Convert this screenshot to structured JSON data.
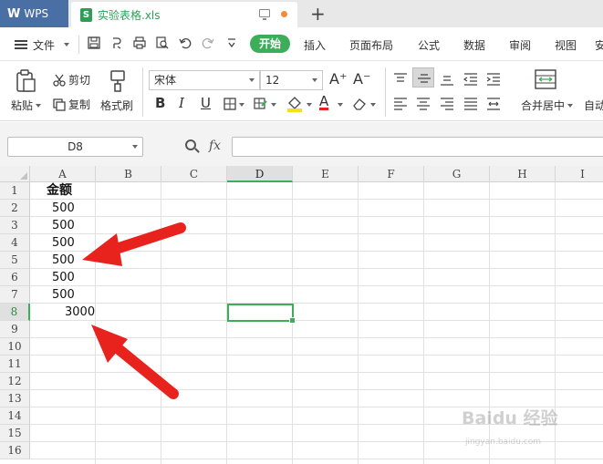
{
  "titlebar": {
    "app_name": "WPS",
    "document_name": "实验表格.xls",
    "sheet_icon_letter": "S",
    "new_tab_glyph": "+"
  },
  "menu": {
    "file_label": "文件",
    "tabs": [
      "开始",
      "插入",
      "页面布局",
      "公式",
      "数据",
      "审阅",
      "视图",
      "安"
    ]
  },
  "ribbon": {
    "paste": "粘贴",
    "cut": "剪切",
    "copy": "复制",
    "format_painter": "格式刷",
    "font_name": "宋体",
    "font_size": "12",
    "grow_font": "A⁺",
    "shrink_font": "A⁻",
    "bold": "B",
    "italic": "I",
    "underline": "U",
    "font_color_letter": "A",
    "merge_center": "合并居中",
    "auto_wrap": "自动"
  },
  "formula_bar": {
    "name_box": "D8",
    "fx_label": "fx",
    "formula": ""
  },
  "sheet": {
    "columns": [
      "A",
      "B",
      "C",
      "D",
      "E",
      "F",
      "G",
      "H",
      "I"
    ],
    "rows": [
      "1",
      "2",
      "3",
      "4",
      "5",
      "6",
      "7",
      "8",
      "9",
      "10",
      "11",
      "12",
      "13",
      "14",
      "15",
      "16"
    ],
    "active_cell": "D8",
    "cells": {
      "A1": "金额",
      "A2": "500",
      "A3": "500",
      "A4": "500",
      "A5": "500",
      "A6": "500",
      "A7": "500",
      "A8": "3000"
    }
  },
  "annotations": {
    "arrow_color": "#e8231e"
  },
  "watermark": {
    "brand": "Baidu 经验",
    "url": "jingyan.baidu.com"
  },
  "colors": {
    "accent": "#3cae5a",
    "wps_tab": "#4a6fa5"
  }
}
